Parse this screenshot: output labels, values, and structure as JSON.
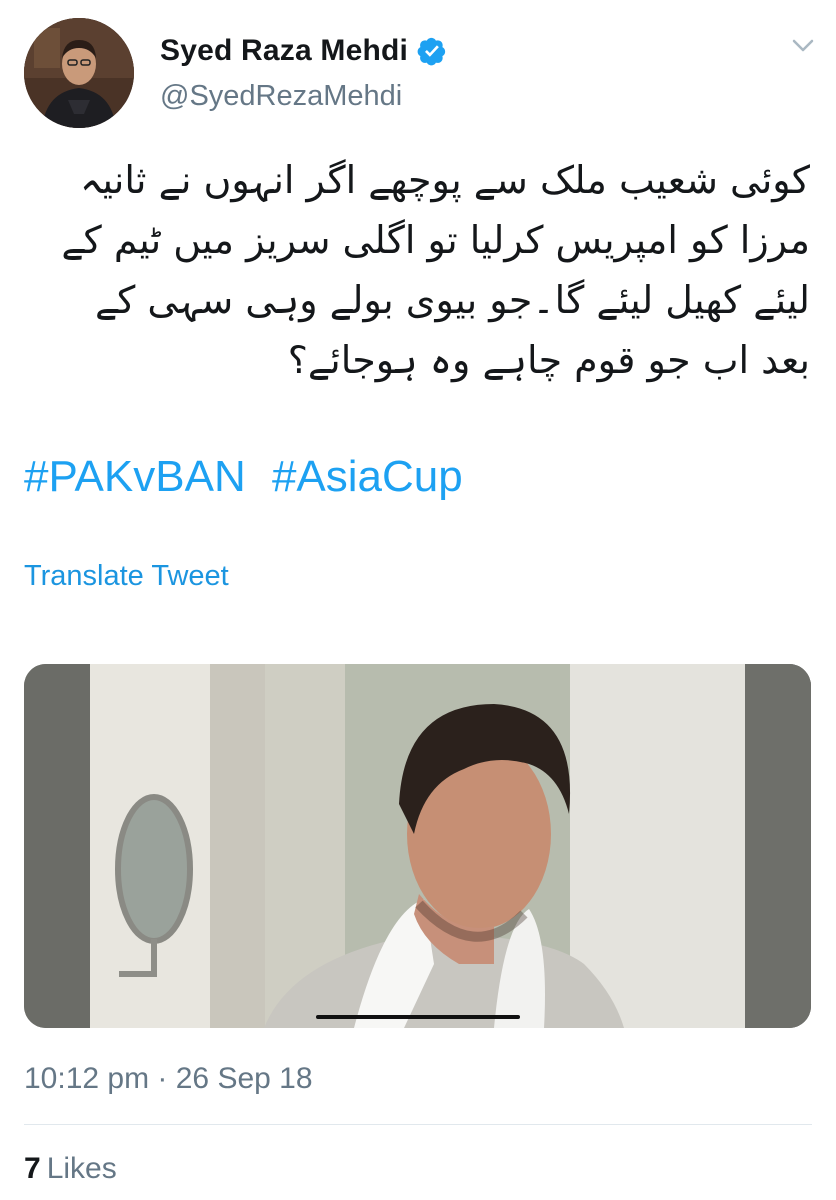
{
  "author": {
    "display_name": "Syed Raza Mehdi",
    "handle": "@SyedRezaMehdi",
    "verified": true,
    "verified_icon": "verified-badge-icon",
    "avatar": "profile-photo"
  },
  "tweet": {
    "text": "کوئی شعیب ملک سے پوچھے اگر انہوں نے ثانیہ\nمرزا کو امپریس کرلیا تو اگلی سریز میں ٹیم کے\nلیئے کھیل لیئے گا۔جو بیوی بولے وہی سہی کے\nبعد اب جو قوم چاہے وہ ہوجائے؟",
    "hashtags": [
      "#PAKvBAN",
      "#AsiaCup"
    ],
    "translate_label": "Translate Tweet",
    "media": {
      "type": "video",
      "description": "man with towel on shoulders touching face in bathroom mirror",
      "progress": 0.0
    },
    "timestamp": "10:12 pm · 26 Sep 18",
    "likes_count": "7",
    "likes_label": "Likes"
  },
  "colors": {
    "link": "#1da1f2",
    "secondary_text": "#657786",
    "divider": "#e1e8ed"
  }
}
